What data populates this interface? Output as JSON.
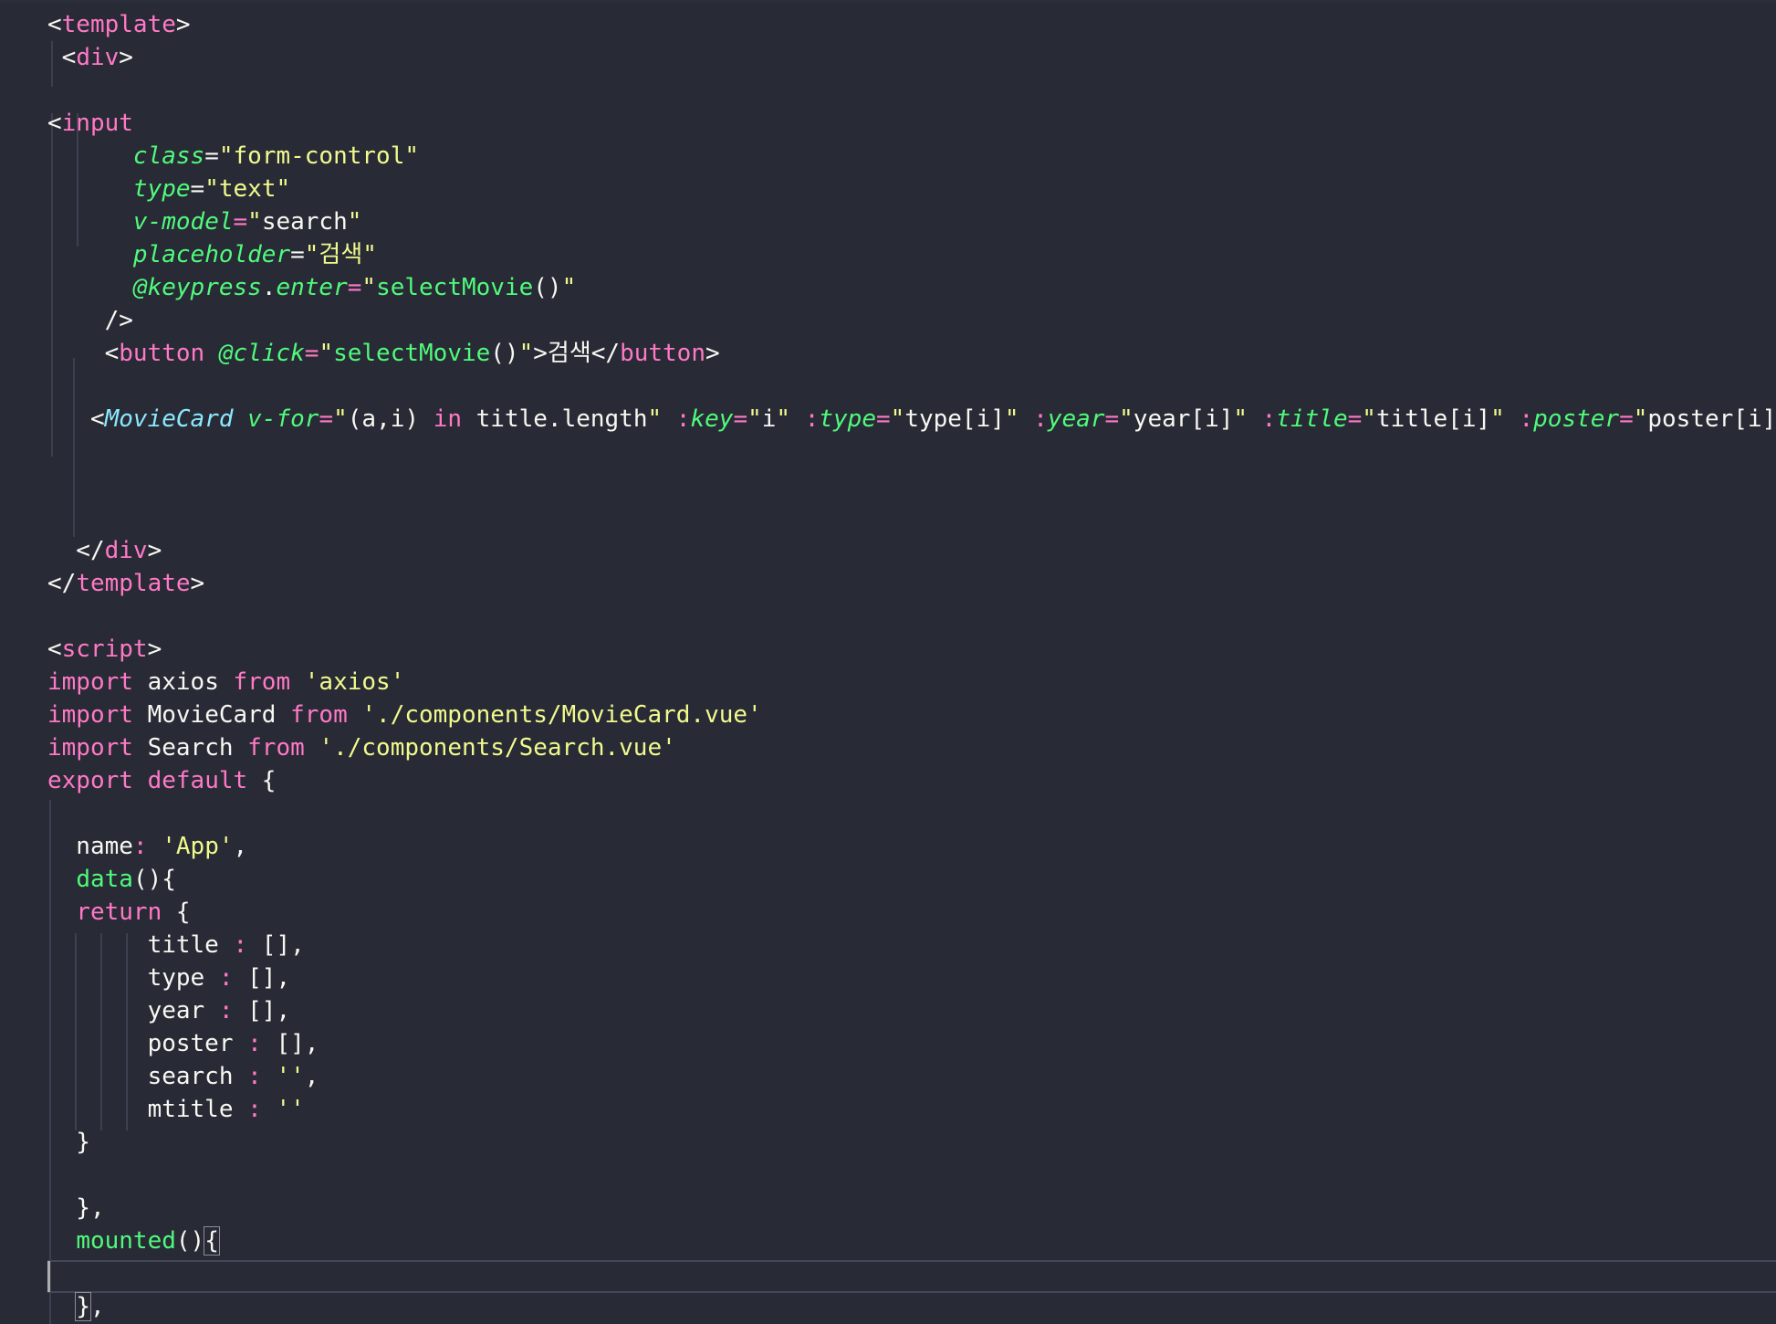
{
  "editor": {
    "theme_colors": {
      "background": "#282a36",
      "tag": "#ff79c6",
      "component": "#8be9fd",
      "attribute": "#50fa7b",
      "string": "#f1fa8c",
      "text": "#f8f8f2"
    },
    "lines": [
      [
        {
          "t": "<",
          "c": "plain"
        },
        {
          "t": "template",
          "c": "tag"
        },
        {
          "t": ">",
          "c": "plain"
        }
      ],
      [
        {
          "t": " <",
          "c": "plain"
        },
        {
          "t": "div",
          "c": "tag"
        },
        {
          "t": ">",
          "c": "plain"
        }
      ],
      [],
      [
        {
          "t": "<",
          "c": "plain"
        },
        {
          "t": "input",
          "c": "tag"
        }
      ],
      [
        {
          "t": "      ",
          "c": "plain"
        },
        {
          "t": "class",
          "c": "attr"
        },
        {
          "t": "=",
          "c": "plain"
        },
        {
          "t": "\"form-control\"",
          "c": "str"
        }
      ],
      [
        {
          "t": "      ",
          "c": "plain"
        },
        {
          "t": "type",
          "c": "attr"
        },
        {
          "t": "=",
          "c": "plain"
        },
        {
          "t": "\"text\"",
          "c": "str"
        }
      ],
      [
        {
          "t": "      ",
          "c": "plain"
        },
        {
          "t": "v-model",
          "c": "attr"
        },
        {
          "t": "=",
          "c": "op"
        },
        {
          "t": "\"",
          "c": "str"
        },
        {
          "t": "search",
          "c": "plain"
        },
        {
          "t": "\"",
          "c": "str"
        }
      ],
      [
        {
          "t": "      ",
          "c": "plain"
        },
        {
          "t": "placeholder",
          "c": "attr"
        },
        {
          "t": "=",
          "c": "plain"
        },
        {
          "t": "\"검색\"",
          "c": "str"
        }
      ],
      [
        {
          "t": "      ",
          "c": "plain"
        },
        {
          "t": "@keypress",
          "c": "attr"
        },
        {
          "t": ".",
          "c": "plain"
        },
        {
          "t": "enter",
          "c": "attr"
        },
        {
          "t": "=",
          "c": "op"
        },
        {
          "t": "\"",
          "c": "str"
        },
        {
          "t": "selectMovie",
          "c": "fn"
        },
        {
          "t": "()",
          "c": "plain"
        },
        {
          "t": "\"",
          "c": "str"
        }
      ],
      [
        {
          "t": "    />",
          "c": "plain"
        }
      ],
      [
        {
          "t": "    <",
          "c": "plain"
        },
        {
          "t": "button",
          "c": "tag"
        },
        {
          "t": " ",
          "c": "plain"
        },
        {
          "t": "@click",
          "c": "attr"
        },
        {
          "t": "=",
          "c": "op"
        },
        {
          "t": "\"",
          "c": "str"
        },
        {
          "t": "selectMovie",
          "c": "fn"
        },
        {
          "t": "()",
          "c": "plain"
        },
        {
          "t": "\"",
          "c": "str"
        },
        {
          "t": ">검색</",
          "c": "plain"
        },
        {
          "t": "button",
          "c": "tag"
        },
        {
          "t": ">",
          "c": "plain"
        }
      ],
      [],
      [
        {
          "t": "   <",
          "c": "plain"
        },
        {
          "t": "MovieCard",
          "c": "comp"
        },
        {
          "t": " ",
          "c": "plain"
        },
        {
          "t": "v-for",
          "c": "attr"
        },
        {
          "t": "=",
          "c": "op"
        },
        {
          "t": "\"",
          "c": "str"
        },
        {
          "t": "(a,i) ",
          "c": "plain"
        },
        {
          "t": "in",
          "c": "kw"
        },
        {
          "t": " title.length",
          "c": "plain"
        },
        {
          "t": "\"",
          "c": "str"
        },
        {
          "t": " :",
          "c": "op"
        },
        {
          "t": "key",
          "c": "attr"
        },
        {
          "t": "=",
          "c": "op"
        },
        {
          "t": "\"",
          "c": "str"
        },
        {
          "t": "i",
          "c": "plain"
        },
        {
          "t": "\"",
          "c": "str"
        },
        {
          "t": " :",
          "c": "op"
        },
        {
          "t": "type",
          "c": "attr"
        },
        {
          "t": "=",
          "c": "op"
        },
        {
          "t": "\"",
          "c": "str"
        },
        {
          "t": "type[i]",
          "c": "plain"
        },
        {
          "t": "\"",
          "c": "str"
        },
        {
          "t": " :",
          "c": "op"
        },
        {
          "t": "year",
          "c": "attr"
        },
        {
          "t": "=",
          "c": "op"
        },
        {
          "t": "\"",
          "c": "str"
        },
        {
          "t": "year[i]",
          "c": "plain"
        },
        {
          "t": "\"",
          "c": "str"
        },
        {
          "t": " :",
          "c": "op"
        },
        {
          "t": "title",
          "c": "attr"
        },
        {
          "t": "=",
          "c": "op"
        },
        {
          "t": "\"",
          "c": "str"
        },
        {
          "t": "title[i]",
          "c": "plain"
        },
        {
          "t": "\"",
          "c": "str"
        },
        {
          "t": " :",
          "c": "op"
        },
        {
          "t": "poster",
          "c": "attr"
        },
        {
          "t": "=",
          "c": "op"
        },
        {
          "t": "\"",
          "c": "str"
        },
        {
          "t": "poster[i]",
          "c": "plain"
        },
        {
          "t": "\"",
          "c": "str"
        },
        {
          "t": "/>",
          "c": "plain"
        }
      ],
      [],
      [],
      [],
      [
        {
          "t": "  </",
          "c": "plain"
        },
        {
          "t": "div",
          "c": "tag"
        },
        {
          "t": ">",
          "c": "plain"
        }
      ],
      [
        {
          "t": "</",
          "c": "plain"
        },
        {
          "t": "template",
          "c": "tag"
        },
        {
          "t": ">",
          "c": "plain"
        }
      ],
      [],
      [
        {
          "t": "<",
          "c": "plain"
        },
        {
          "t": "script",
          "c": "tag"
        },
        {
          "t": ">",
          "c": "plain"
        }
      ],
      [
        {
          "t": "import",
          "c": "kw"
        },
        {
          "t": " axios ",
          "c": "plain"
        },
        {
          "t": "from",
          "c": "kw"
        },
        {
          "t": " ",
          "c": "plain"
        },
        {
          "t": "'axios'",
          "c": "str"
        }
      ],
      [
        {
          "t": "import",
          "c": "kw"
        },
        {
          "t": " MovieCard ",
          "c": "plain"
        },
        {
          "t": "from",
          "c": "kw"
        },
        {
          "t": " ",
          "c": "plain"
        },
        {
          "t": "'./components/MovieCard.vue'",
          "c": "str"
        }
      ],
      [
        {
          "t": "import",
          "c": "kw"
        },
        {
          "t": " Search ",
          "c": "plain"
        },
        {
          "t": "from",
          "c": "kw"
        },
        {
          "t": " ",
          "c": "plain"
        },
        {
          "t": "'./components/Search.vue'",
          "c": "str"
        }
      ],
      [
        {
          "t": "export",
          "c": "kw"
        },
        {
          "t": " ",
          "c": "plain"
        },
        {
          "t": "default",
          "c": "kw"
        },
        {
          "t": " {",
          "c": "plain"
        }
      ],
      [],
      [
        {
          "t": "  name",
          "c": "plain"
        },
        {
          "t": ":",
          "c": "op"
        },
        {
          "t": " ",
          "c": "plain"
        },
        {
          "t": "'App'",
          "c": "str"
        },
        {
          "t": ",",
          "c": "plain"
        }
      ],
      [
        {
          "t": "  ",
          "c": "plain"
        },
        {
          "t": "data",
          "c": "fn"
        },
        {
          "t": "(){",
          "c": "plain"
        }
      ],
      [
        {
          "t": "  ",
          "c": "plain"
        },
        {
          "t": "return",
          "c": "kw"
        },
        {
          "t": " {",
          "c": "plain"
        }
      ],
      [
        {
          "t": "       title ",
          "c": "plain"
        },
        {
          "t": ":",
          "c": "op"
        },
        {
          "t": " [],",
          "c": "plain"
        }
      ],
      [
        {
          "t": "       type ",
          "c": "plain"
        },
        {
          "t": ":",
          "c": "op"
        },
        {
          "t": " [],",
          "c": "plain"
        }
      ],
      [
        {
          "t": "       year ",
          "c": "plain"
        },
        {
          "t": ":",
          "c": "op"
        },
        {
          "t": " [],",
          "c": "plain"
        }
      ],
      [
        {
          "t": "       poster ",
          "c": "plain"
        },
        {
          "t": ":",
          "c": "op"
        },
        {
          "t": " [],",
          "c": "plain"
        }
      ],
      [
        {
          "t": "       search ",
          "c": "plain"
        },
        {
          "t": ":",
          "c": "op"
        },
        {
          "t": " ",
          "c": "plain"
        },
        {
          "t": "''",
          "c": "str"
        },
        {
          "t": ",",
          "c": "plain"
        }
      ],
      [
        {
          "t": "       mtitle ",
          "c": "plain"
        },
        {
          "t": ":",
          "c": "op"
        },
        {
          "t": " ",
          "c": "plain"
        },
        {
          "t": "''",
          "c": "str"
        }
      ],
      [
        {
          "t": "  }",
          "c": "plain"
        }
      ],
      [],
      [
        {
          "t": "  },",
          "c": "plain"
        }
      ],
      [
        {
          "t": "  ",
          "c": "plain"
        },
        {
          "t": "mounted",
          "c": "fn"
        },
        {
          "t": "()",
          "c": "plain"
        },
        {
          "t": "{",
          "c": "bracket"
        }
      ],
      [],
      [
        {
          "t": "  ",
          "c": "plain"
        },
        {
          "t": "}",
          "c": "bracket"
        },
        {
          "t": ",",
          "c": "plain"
        }
      ]
    ]
  }
}
